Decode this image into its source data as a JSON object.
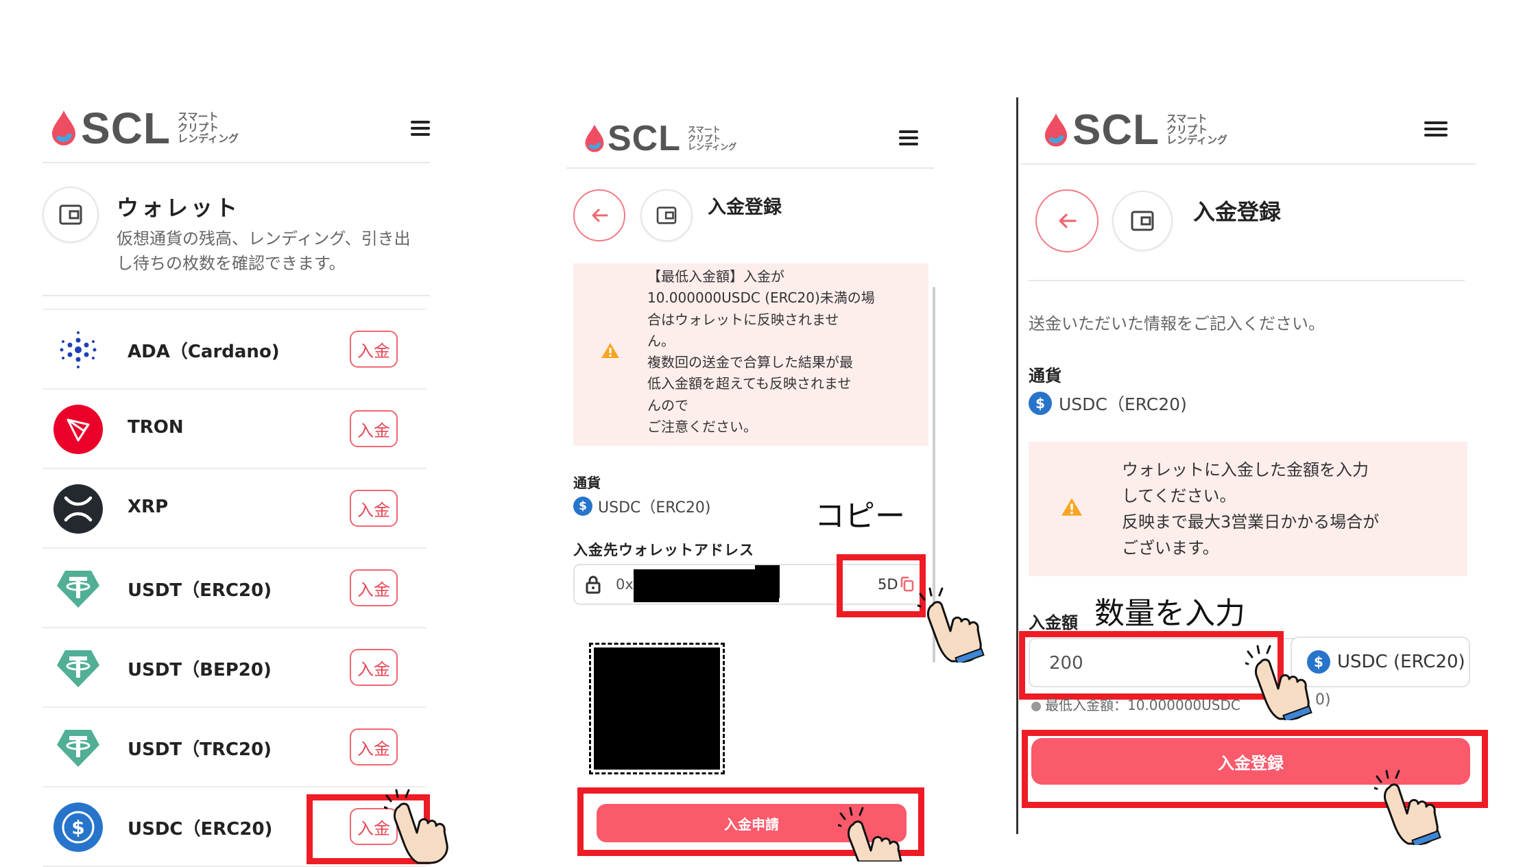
{
  "brand": {
    "name": "SCL",
    "sub_lines": [
      "スマート",
      "クリプト",
      "レンディング"
    ],
    "accent": "#fb5a6b",
    "frame_color": "#ee1c25"
  },
  "panel1": {
    "title": "ウォレット",
    "description_line1": "仮想通貨の残高、レンディング、引き出",
    "description_line2": "し待ちの枚数を確認できます。",
    "deposit_label": "入金",
    "coins": [
      {
        "name": "ADA（Cardano)",
        "icon": "cardano-icon",
        "color": "#1f3fb5"
      },
      {
        "name": "TRON",
        "icon": "tron-icon",
        "color": "#eb0029"
      },
      {
        "name": "XRP",
        "icon": "xrp-icon",
        "color": "#23292f"
      },
      {
        "name": "USDT（ERC20)",
        "icon": "tether-icon",
        "color": "#50af95"
      },
      {
        "name": "USDT（BEP20)",
        "icon": "tether-icon",
        "color": "#50af95"
      },
      {
        "name": "USDT（TRC20)",
        "icon": "tether-icon",
        "color": "#50af95"
      },
      {
        "name": "USDC（ERC20)",
        "icon": "usdc-icon",
        "color": "#2775ca"
      }
    ]
  },
  "panel2": {
    "title": "入金登録",
    "warning_lines": [
      "【最低入金額】入金が",
      "10.000000USDC (ERC20)未満の場",
      "合はウォレットに反映されませ",
      "ん。",
      "複数回の送金で合算した結果が最",
      "低入金額を超えても反映されませ",
      "んので",
      "ご注意ください。"
    ],
    "currency_label": "通貨",
    "currency_value": "USDC（ERC20)",
    "address_label": "入金先ウォレットアドレス",
    "address_prefix": "0x",
    "address_suffix": "5D",
    "copy_annotation": "コピー",
    "submit_label": "入金申請"
  },
  "panel3": {
    "title": "入金登録",
    "intro": "送金いただいた情報をご記入ください。",
    "currency_label": "通貨",
    "currency_value": "USDC（ERC20)",
    "warning_lines": [
      "ウォレットに入金した金額を入力",
      "してください。",
      "反映まで最大3営業日かかる場合が",
      "ございます。"
    ],
    "amount_label": "入金額",
    "amount_annotation": "数量を入力",
    "amount_value": "200",
    "amount_currency": "USDC (ERC20)",
    "min_note_partial": "最低入金額：10.000000USDC",
    "min_note_tail": "0)",
    "submit_label": "入金登録"
  }
}
